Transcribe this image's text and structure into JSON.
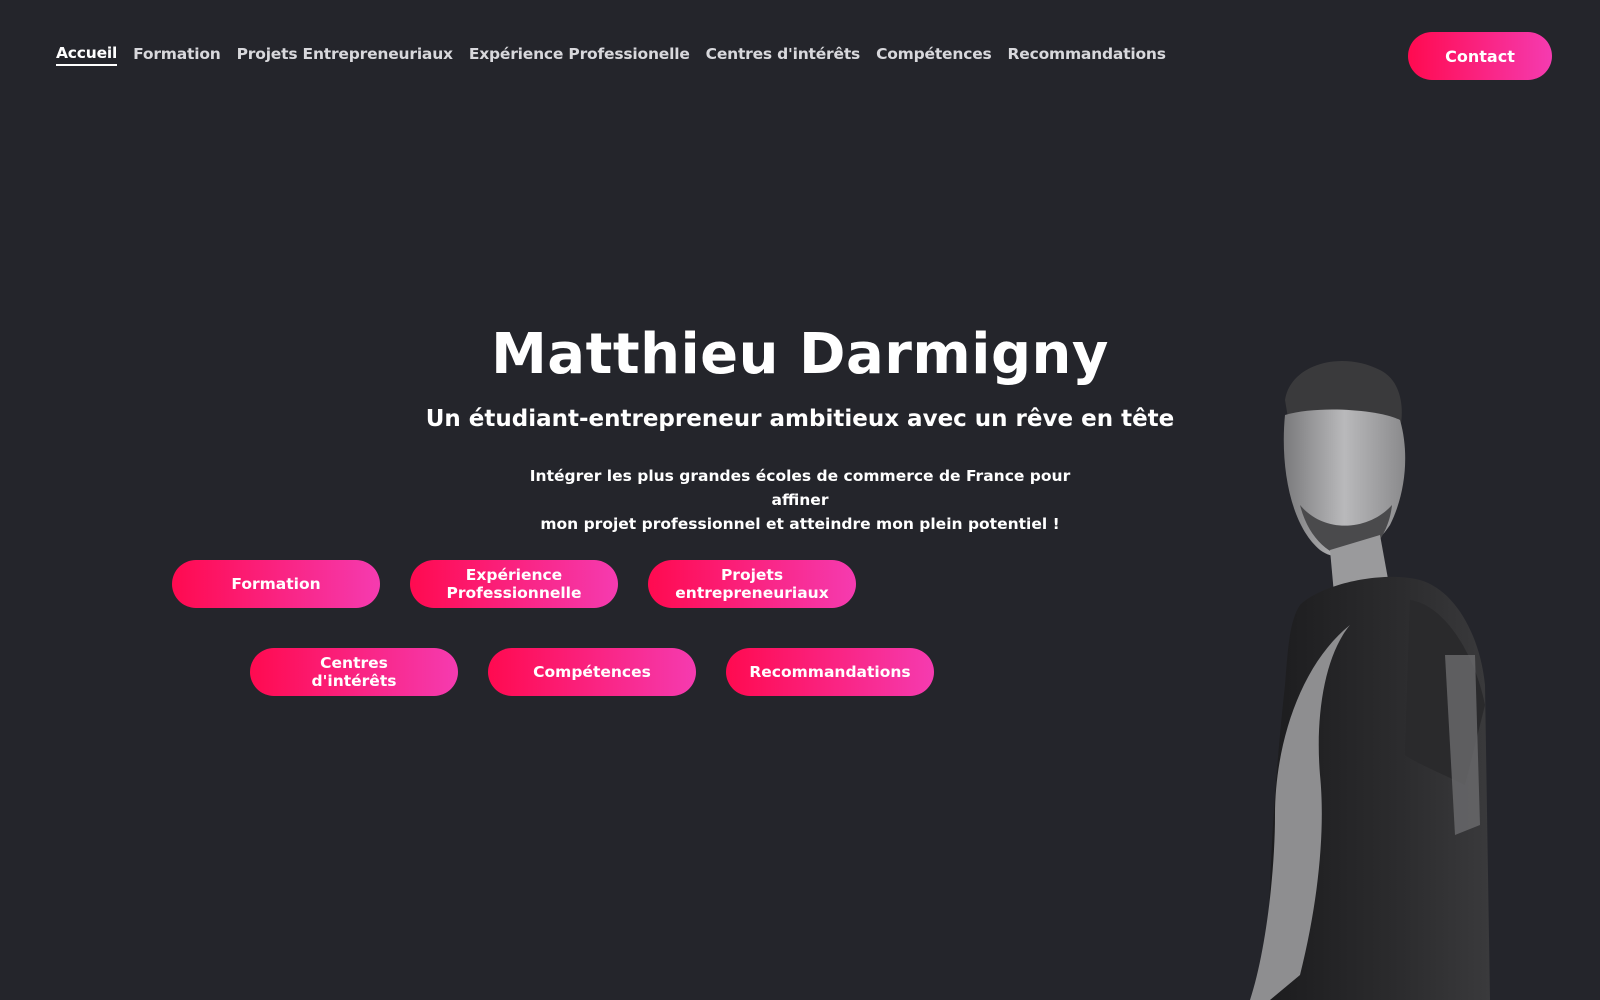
{
  "nav": {
    "items": [
      {
        "label": "Accueil",
        "active": true
      },
      {
        "label": "Formation",
        "active": false
      },
      {
        "label": "Projets Entrepreneuriaux",
        "active": false
      },
      {
        "label": "Expérience Professionelle",
        "active": false
      },
      {
        "label": "Centres d'intérêts",
        "active": false
      },
      {
        "label": "Compétences",
        "active": false
      },
      {
        "label": "Recommandations",
        "active": false
      }
    ],
    "contact_label": "Contact"
  },
  "hero": {
    "title": "Matthieu Darmigny",
    "subtitle": "Un étudiant-entrepreneur ambitieux avec un rêve en tête",
    "description_line1": "Intégrer les plus grandes écoles de commerce de France pour affiner",
    "description_line2": "mon projet professionnel et atteindre mon plein potentiel !"
  },
  "buttons": {
    "formation": "Formation",
    "experience_line1": "Expérience",
    "experience_line2": "Professionnelle",
    "projets_line1": "Projets",
    "projets_line2": "entrepreneuriaux",
    "centres": "Centres d'intérêts",
    "competences": "Compétences",
    "recommandations": "Recommandations"
  },
  "colors": {
    "background": "#24252b",
    "accent_start": "#ff0a50",
    "accent_end": "#f53bb0",
    "text": "#ffffff"
  },
  "icons": {
    "portrait": "portrait-photo"
  }
}
